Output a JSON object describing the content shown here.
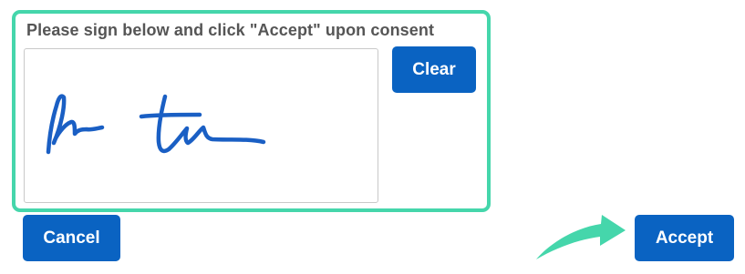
{
  "consent": {
    "prompt": "Please sign below and click \"Accept\" upon consent",
    "frame_color": "#45d6ab"
  },
  "buttons": {
    "clear_label": "Clear",
    "cancel_label": "Cancel",
    "accept_label": "Accept",
    "color": "#0a63c2"
  },
  "signature": {
    "ink_color": "#1a5fc4",
    "present": true
  },
  "hint_arrow": {
    "icon": "arrow-right-icon",
    "color": "#45d6ab"
  }
}
